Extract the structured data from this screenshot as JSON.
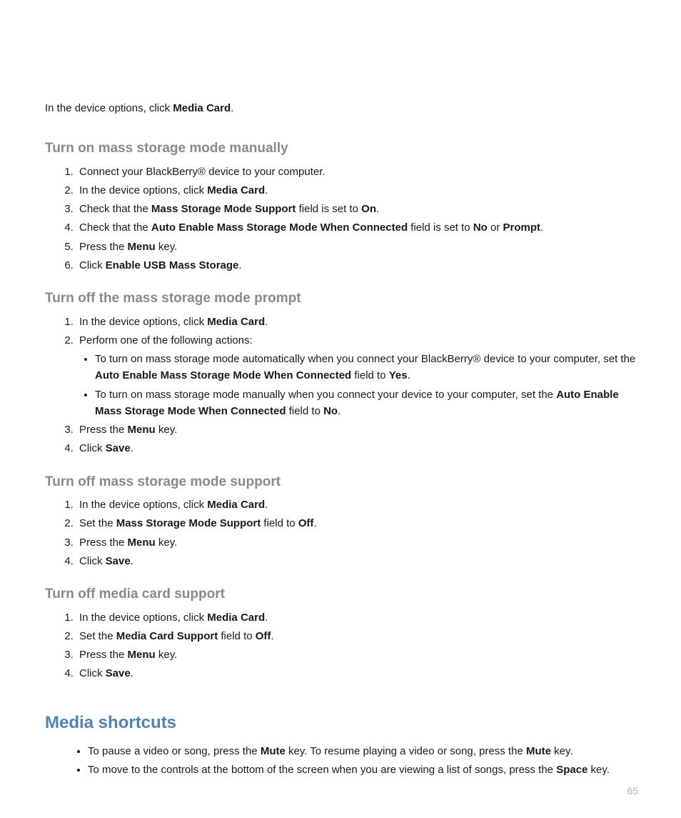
{
  "intro": {
    "t1": "In the device options, click ",
    "b1": "Media Card",
    "t2": "."
  },
  "sec1": {
    "heading": "Turn on mass storage mode manually",
    "s1": {
      "t1": "Connect your BlackBerry® device to your computer."
    },
    "s2": {
      "t1": "In the device options, click ",
      "b1": "Media Card",
      "t2": "."
    },
    "s3": {
      "t1": "Check that the ",
      "b1": "Mass Storage Mode Support",
      "t2": " field is set to ",
      "b2": "On",
      "t3": "."
    },
    "s4": {
      "t1": "Check that the ",
      "b1": "Auto Enable Mass Storage Mode When Connected",
      "t2": " field is set to ",
      "b2": "No",
      "t3": " or ",
      "b3": "Prompt",
      "t4": "."
    },
    "s5": {
      "t1": "Press the ",
      "b1": "Menu",
      "t2": " key."
    },
    "s6": {
      "t1": "Click ",
      "b1": "Enable USB Mass Storage",
      "t2": "."
    }
  },
  "sec2": {
    "heading": "Turn off the mass storage mode prompt",
    "s1": {
      "t1": "In the device options, click ",
      "b1": "Media Card",
      "t2": "."
    },
    "s2": {
      "t1": "Perform one of the following actions:"
    },
    "s2a": {
      "t1": "To turn on mass storage mode automatically when you connect your BlackBerry® device to your computer, set the ",
      "b1": "Auto Enable Mass Storage Mode When Connected",
      "t2": " field to ",
      "b2": "Yes",
      "t3": "."
    },
    "s2b": {
      "t1": "To turn on mass storage mode manually when you connect your device to your computer, set the ",
      "b1": "Auto Enable Mass Storage Mode When Connected",
      "t2": " field to ",
      "b2": "No",
      "t3": "."
    },
    "s3": {
      "t1": "Press the ",
      "b1": "Menu",
      "t2": " key."
    },
    "s4": {
      "t1": "Click ",
      "b1": "Save",
      "t2": "."
    }
  },
  "sec3": {
    "heading": "Turn off mass storage mode support",
    "s1": {
      "t1": "In the device options, click ",
      "b1": "Media Card",
      "t2": "."
    },
    "s2": {
      "t1": "Set the ",
      "b1": "Mass Storage Mode Support",
      "t2": " field to ",
      "b2": "Off",
      "t3": "."
    },
    "s3": {
      "t1": "Press the ",
      "b1": "Menu",
      "t2": " key."
    },
    "s4": {
      "t1": "Click ",
      "b1": "Save",
      "t2": "."
    }
  },
  "sec4": {
    "heading": "Turn off media card support",
    "s1": {
      "t1": "In the device options, click ",
      "b1": "Media Card",
      "t2": "."
    },
    "s2": {
      "t1": "Set the ",
      "b1": "Media Card Support",
      "t2": " field to ",
      "b2": "Off",
      "t3": "."
    },
    "s3": {
      "t1": "Press the ",
      "b1": "Menu",
      "t2": " key."
    },
    "s4": {
      "t1": "Click ",
      "b1": "Save",
      "t2": "."
    }
  },
  "shortcuts": {
    "heading": "Media shortcuts",
    "i1": {
      "t1": "To pause a video or song, press the ",
      "b1": "Mute",
      "t2": " key. To resume playing a video or song, press the ",
      "b2": "Mute",
      "t3": " key."
    },
    "i2": {
      "t1": "To move to the controls at the bottom of the screen when you are viewing a list of songs, press the ",
      "b1": "Space",
      "t2": " key."
    }
  },
  "page_number": "65"
}
